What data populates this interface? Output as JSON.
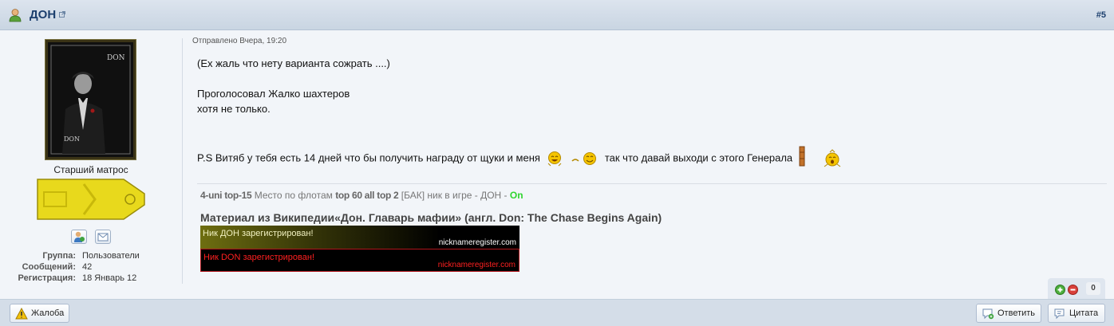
{
  "header": {
    "author_name": "ДОН",
    "post_number": "#5"
  },
  "author": {
    "avatar_caption_top": "DON",
    "avatar_caption_bottom": "DON",
    "rank_title": "Старший матрос",
    "info": [
      {
        "label": "Группа:",
        "value": "Пользователи"
      },
      {
        "label": "Сообщений:",
        "value": "42"
      },
      {
        "label": "Регистрация:",
        "value": "18 Январь 12"
      }
    ]
  },
  "post": {
    "date": "Отправлено Вчера, 19:20",
    "line1": "(Ех жаль что нету варианта сожрать ....)",
    "line2": "Проголосовал Жалко шахтеров",
    "line3": "хотя не только.",
    "line4_a": "P.S Витяб у тебя есть 14 дней что бы получить награду от щуки и меня",
    "line4_b": "так что давай выходи с этого Генерала"
  },
  "signature": {
    "seg1": "4-uni top-15",
    "seg2": " Место по флотам ",
    "seg3": "top 60 all top 2",
    "seg4": " [БАК] ник в игре - ДОН - ",
    "seg5": "On",
    "line2": "Материал из Википедии«Дон. Главарь мафии» (англ. Don: The Chase Begins Again)",
    "banner1_text": "Ник ДОН зарегистрирован!",
    "banner1_site": "nicknameregister.com",
    "banner2_text": "Ник DON зарегистрирован!",
    "banner2_site": "nicknameregister.com"
  },
  "rating": {
    "count": "0"
  },
  "footer": {
    "report_label": "Жалоба",
    "reply_label": "Ответить",
    "quote_label": "Цитата"
  },
  "colors": {
    "header_link": "#1c3f6e",
    "signature_online": "#2fd52f",
    "banner2_text": "#ff2020"
  }
}
